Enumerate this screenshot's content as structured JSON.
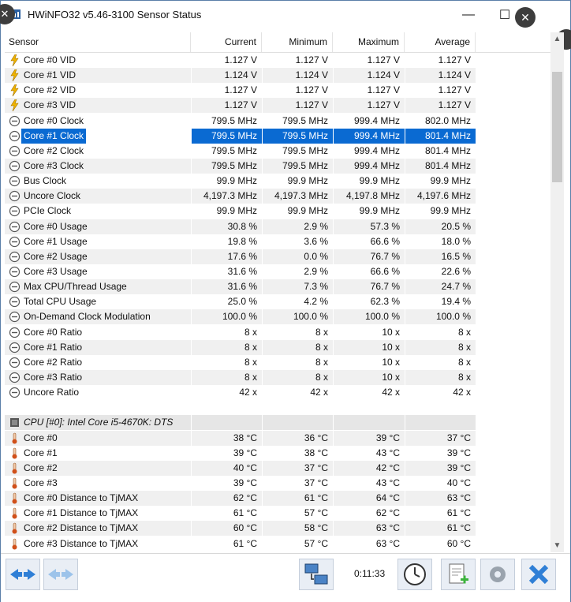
{
  "window": {
    "title": "HWiNFO32 v5.46-3100 Sensor Status",
    "minimize_glyph": "—",
    "maximize_glyph": "☐",
    "close_glyph": "✕",
    "overlay_close_glyph": "✕"
  },
  "columns": {
    "sensor": "Sensor",
    "current": "Current",
    "minimum": "Minimum",
    "maximum": "Maximum",
    "average": "Average"
  },
  "rows": [
    {
      "icon": "voltage-bolt-icon",
      "sensor": "Core #0 VID",
      "current": "1.127 V",
      "minimum": "1.127 V",
      "maximum": "1.127 V",
      "average": "1.127 V"
    },
    {
      "icon": "voltage-bolt-icon",
      "sensor": "Core #1 VID",
      "current": "1.124 V",
      "minimum": "1.124 V",
      "maximum": "1.124 V",
      "average": "1.124 V"
    },
    {
      "icon": "voltage-bolt-icon",
      "sensor": "Core #2 VID",
      "current": "1.127 V",
      "minimum": "1.127 V",
      "maximum": "1.127 V",
      "average": "1.127 V"
    },
    {
      "icon": "voltage-bolt-icon",
      "sensor": "Core #3 VID",
      "current": "1.127 V",
      "minimum": "1.127 V",
      "maximum": "1.127 V",
      "average": "1.127 V"
    },
    {
      "icon": "gauge-icon",
      "sensor": "Core #0 Clock",
      "current": "799.5 MHz",
      "minimum": "799.5 MHz",
      "maximum": "999.4 MHz",
      "average": "802.0 MHz"
    },
    {
      "icon": "gauge-icon",
      "sensor": "Core #1 Clock",
      "current": "799.5 MHz",
      "minimum": "799.5 MHz",
      "maximum": "999.4 MHz",
      "average": "801.4 MHz",
      "selected": true
    },
    {
      "icon": "gauge-icon",
      "sensor": "Core #2 Clock",
      "current": "799.5 MHz",
      "minimum": "799.5 MHz",
      "maximum": "999.4 MHz",
      "average": "801.4 MHz"
    },
    {
      "icon": "gauge-icon",
      "sensor": "Core #3 Clock",
      "current": "799.5 MHz",
      "minimum": "799.5 MHz",
      "maximum": "999.4 MHz",
      "average": "801.4 MHz"
    },
    {
      "icon": "gauge-icon",
      "sensor": "Bus Clock",
      "current": "99.9 MHz",
      "minimum": "99.9 MHz",
      "maximum": "99.9 MHz",
      "average": "99.9 MHz"
    },
    {
      "icon": "gauge-icon",
      "sensor": "Uncore Clock",
      "current": "4,197.3 MHz",
      "minimum": "4,197.3 MHz",
      "maximum": "4,197.8 MHz",
      "average": "4,197.6 MHz"
    },
    {
      "icon": "gauge-icon",
      "sensor": "PCIe Clock",
      "current": "99.9 MHz",
      "minimum": "99.9 MHz",
      "maximum": "99.9 MHz",
      "average": "99.9 MHz"
    },
    {
      "icon": "gauge-icon",
      "sensor": "Core #0 Usage",
      "current": "30.8 %",
      "minimum": "2.9 %",
      "maximum": "57.3 %",
      "average": "20.5 %"
    },
    {
      "icon": "gauge-icon",
      "sensor": "Core #1 Usage",
      "current": "19.8 %",
      "minimum": "3.6 %",
      "maximum": "66.6 %",
      "average": "18.0 %"
    },
    {
      "icon": "gauge-icon",
      "sensor": "Core #2 Usage",
      "current": "17.6 %",
      "minimum": "0.0 %",
      "maximum": "76.7 %",
      "average": "16.5 %"
    },
    {
      "icon": "gauge-icon",
      "sensor": "Core #3 Usage",
      "current": "31.6 %",
      "minimum": "2.9 %",
      "maximum": "66.6 %",
      "average": "22.6 %"
    },
    {
      "icon": "gauge-icon",
      "sensor": "Max CPU/Thread Usage",
      "current": "31.6 %",
      "minimum": "7.3 %",
      "maximum": "76.7 %",
      "average": "24.7 %"
    },
    {
      "icon": "gauge-icon",
      "sensor": "Total CPU Usage",
      "current": "25.0 %",
      "minimum": "4.2 %",
      "maximum": "62.3 %",
      "average": "19.4 %"
    },
    {
      "icon": "gauge-icon",
      "sensor": "On-Demand Clock Modulation",
      "current": "100.0 %",
      "minimum": "100.0 %",
      "maximum": "100.0 %",
      "average": "100.0 %"
    },
    {
      "icon": "gauge-icon",
      "sensor": "Core #0 Ratio",
      "current": "8 x",
      "minimum": "8 x",
      "maximum": "10 x",
      "average": "8 x"
    },
    {
      "icon": "gauge-icon",
      "sensor": "Core #1 Ratio",
      "current": "8 x",
      "minimum": "8 x",
      "maximum": "10 x",
      "average": "8 x"
    },
    {
      "icon": "gauge-icon",
      "sensor": "Core #2 Ratio",
      "current": "8 x",
      "minimum": "8 x",
      "maximum": "10 x",
      "average": "8 x"
    },
    {
      "icon": "gauge-icon",
      "sensor": "Core #3 Ratio",
      "current": "8 x",
      "minimum": "8 x",
      "maximum": "10 x",
      "average": "8 x"
    },
    {
      "icon": "gauge-icon",
      "sensor": "Uncore Ratio",
      "current": "42 x",
      "minimum": "42 x",
      "maximum": "42 x",
      "average": "42 x"
    },
    {
      "blank": true
    },
    {
      "group": true,
      "icon": "cpu-chip-icon",
      "sensor": "CPU [#0]: Intel Core i5-4670K: DTS"
    },
    {
      "icon": "thermometer-icon",
      "sensor": "Core #0",
      "current": "38 °C",
      "minimum": "36 °C",
      "maximum": "39 °C",
      "average": "37 °C"
    },
    {
      "icon": "thermometer-icon",
      "sensor": "Core #1",
      "current": "39 °C",
      "minimum": "38 °C",
      "maximum": "43 °C",
      "average": "39 °C"
    },
    {
      "icon": "thermometer-icon",
      "sensor": "Core #2",
      "current": "40 °C",
      "minimum": "37 °C",
      "maximum": "42 °C",
      "average": "39 °C"
    },
    {
      "icon": "thermometer-icon",
      "sensor": "Core #3",
      "current": "39 °C",
      "minimum": "37 °C",
      "maximum": "43 °C",
      "average": "40 °C"
    },
    {
      "icon": "thermometer-icon",
      "sensor": "Core #0 Distance to TjMAX",
      "current": "62 °C",
      "minimum": "61 °C",
      "maximum": "64 °C",
      "average": "63 °C"
    },
    {
      "icon": "thermometer-icon",
      "sensor": "Core #1 Distance to TjMAX",
      "current": "61 °C",
      "minimum": "57 °C",
      "maximum": "62 °C",
      "average": "61 °C"
    },
    {
      "icon": "thermometer-icon",
      "sensor": "Core #2 Distance to TjMAX",
      "current": "60 °C",
      "minimum": "58 °C",
      "maximum": "63 °C",
      "average": "61 °C"
    },
    {
      "icon": "thermometer-icon",
      "sensor": "Core #3 Distance to TjMAX",
      "current": "61 °C",
      "minimum": "57 °C",
      "maximum": "63 °C",
      "average": "60 °C"
    }
  ],
  "toolbar": {
    "elapsed_time": "0:11:33",
    "buttons": [
      "nav-arrows-icon",
      "nav-arrows-disabled-icon",
      "network-icon",
      "clock-icon",
      "report-add-icon",
      "settings-gear-icon",
      "close-x-icon"
    ]
  },
  "colors": {
    "selection": "#0a6ad2",
    "alt_row": "#f0f0f0",
    "group_row": "#e6e6e6",
    "accent_blue": "#3a8fd8"
  }
}
